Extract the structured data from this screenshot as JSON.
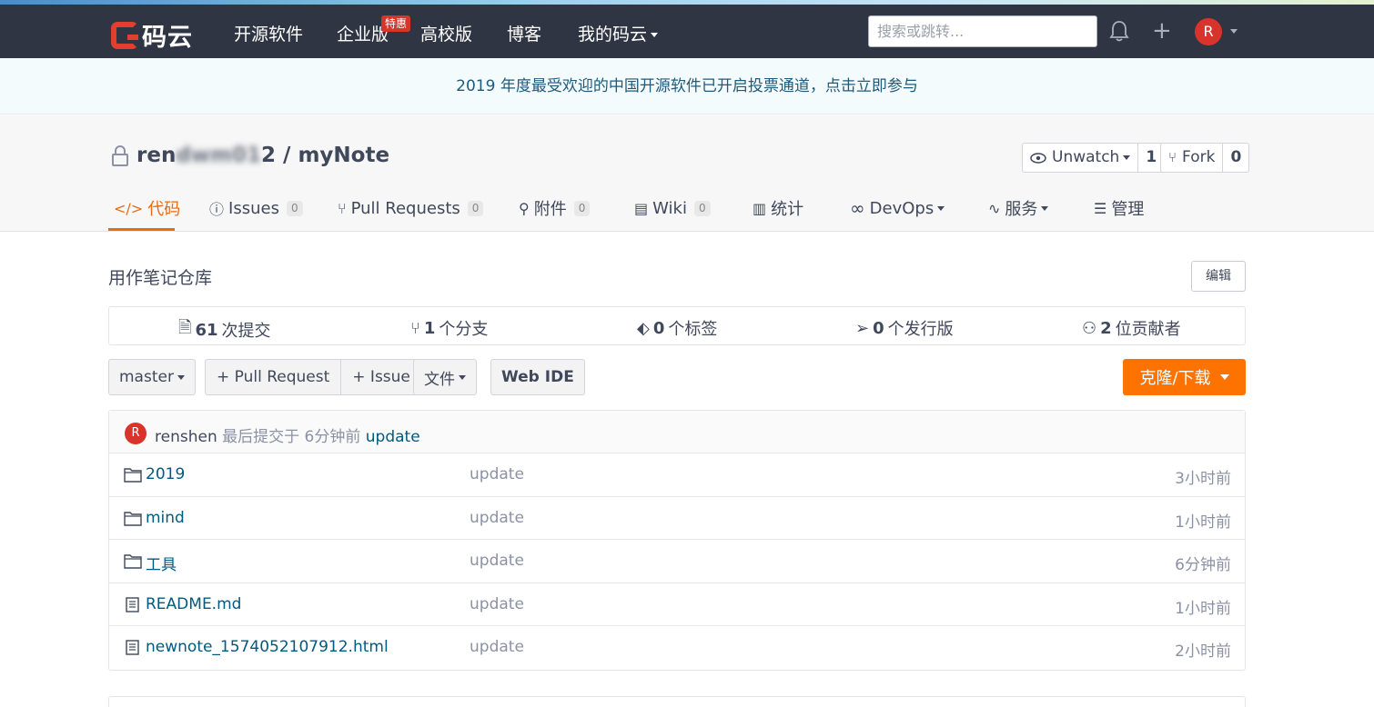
{
  "nav": {
    "logo_text": "码云",
    "links": [
      "开源软件",
      "企业版",
      "高校版",
      "博客"
    ],
    "my_gitee": "我的码云",
    "hot_badge": "特惠",
    "search_placeholder": "搜索或跳转...",
    "avatar_letter": "R"
  },
  "banner": {
    "text": "2019 年度最受欢迎的中国开源软件已开启投票通道，点击立即参与"
  },
  "project": {
    "owner_blurred": "renshen2012",
    "owner_visible": "ren",
    "owner_tail": "2",
    "separator": " / ",
    "name": "myNote",
    "watch_label": "Unwatch",
    "watch_count": "1",
    "fork_label": "Fork",
    "fork_count": "0"
  },
  "tabs": [
    {
      "icon": "</>",
      "label": "代码"
    },
    {
      "icon": "ⓘ",
      "label": "Issues",
      "count": "0"
    },
    {
      "icon": "⑂",
      "label": "Pull Requests",
      "count": "0"
    },
    {
      "icon": "⚲",
      "label": "附件",
      "count": "0"
    },
    {
      "icon": "▤",
      "label": "Wiki",
      "count": "0"
    },
    {
      "icon": "▥",
      "label": "统计"
    },
    {
      "icon": "∞",
      "label": "DevOps"
    },
    {
      "icon": "∿",
      "label": "服务"
    },
    {
      "icon": "☰",
      "label": "管理"
    }
  ],
  "description": "用作笔记仓库",
  "edit_label": "编辑",
  "stats": [
    {
      "num": "61",
      "label": "次提交"
    },
    {
      "num": "1",
      "label": "个分支"
    },
    {
      "num": "0",
      "label": "个标签"
    },
    {
      "num": "0",
      "label": "个发行版"
    },
    {
      "num": "2",
      "label": "位贡献者"
    }
  ],
  "toolbar": {
    "branch": "master",
    "pull_request": "+ Pull Request",
    "issue": "+ Issue",
    "file": "文件",
    "web_ide": "Web IDE",
    "clone": "克隆/下载"
  },
  "commit": {
    "avatar_letter": "R",
    "author": "renshen",
    "text": "最后提交于 6分钟前",
    "message": "update"
  },
  "files": [
    {
      "type": "folder",
      "name": "2019",
      "message": "update",
      "time": "3小时前"
    },
    {
      "type": "folder",
      "name": "mind",
      "message": "update",
      "time": "1小时前"
    },
    {
      "type": "folder",
      "name": "工具",
      "message": "update",
      "time": "6分钟前"
    },
    {
      "type": "file",
      "name": "README.md",
      "message": "update",
      "time": "1小时前"
    },
    {
      "type": "file",
      "name": "newnote_1574052107912.html",
      "message": "update",
      "time": "2小时前"
    }
  ],
  "colors": {
    "nav_bg": "#2f3542",
    "accent_orange": "#fe7300",
    "tab_active": "#e96b15",
    "link": "#005980",
    "brand_red": "#e23f2f"
  }
}
